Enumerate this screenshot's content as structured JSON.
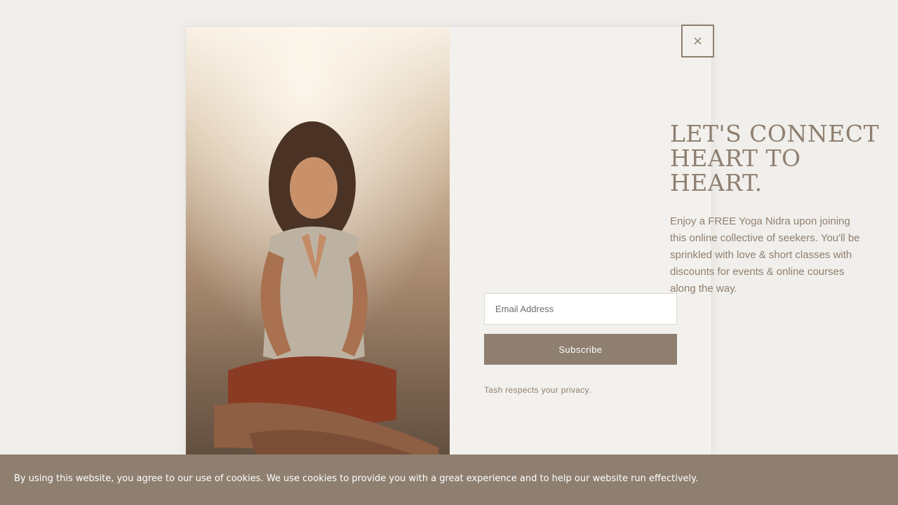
{
  "popup": {
    "close_label": "×",
    "heading_lines": [
      "Let's connect",
      "heart to",
      "heart."
    ],
    "description": "Enjoy a FREE Yoga Nidra upon joining this online collective of seekers. You'll be sprinkled with love & short classes with discounts for events & online courses along the way.",
    "email_placeholder": "Email Address",
    "subscribe_label": "Subscribe",
    "privacy_note": "Tash respects your privacy."
  },
  "cookie_banner": {
    "text": "By using this website, you agree to our use of cookies. We use cookies to provide you with a great experience and to help our website run effectively."
  },
  "colors": {
    "accent": "#8e7f70",
    "page_background": "#f1efeb",
    "popup_background": "#f3f1ed"
  },
  "icons": {
    "close": "close-icon"
  }
}
